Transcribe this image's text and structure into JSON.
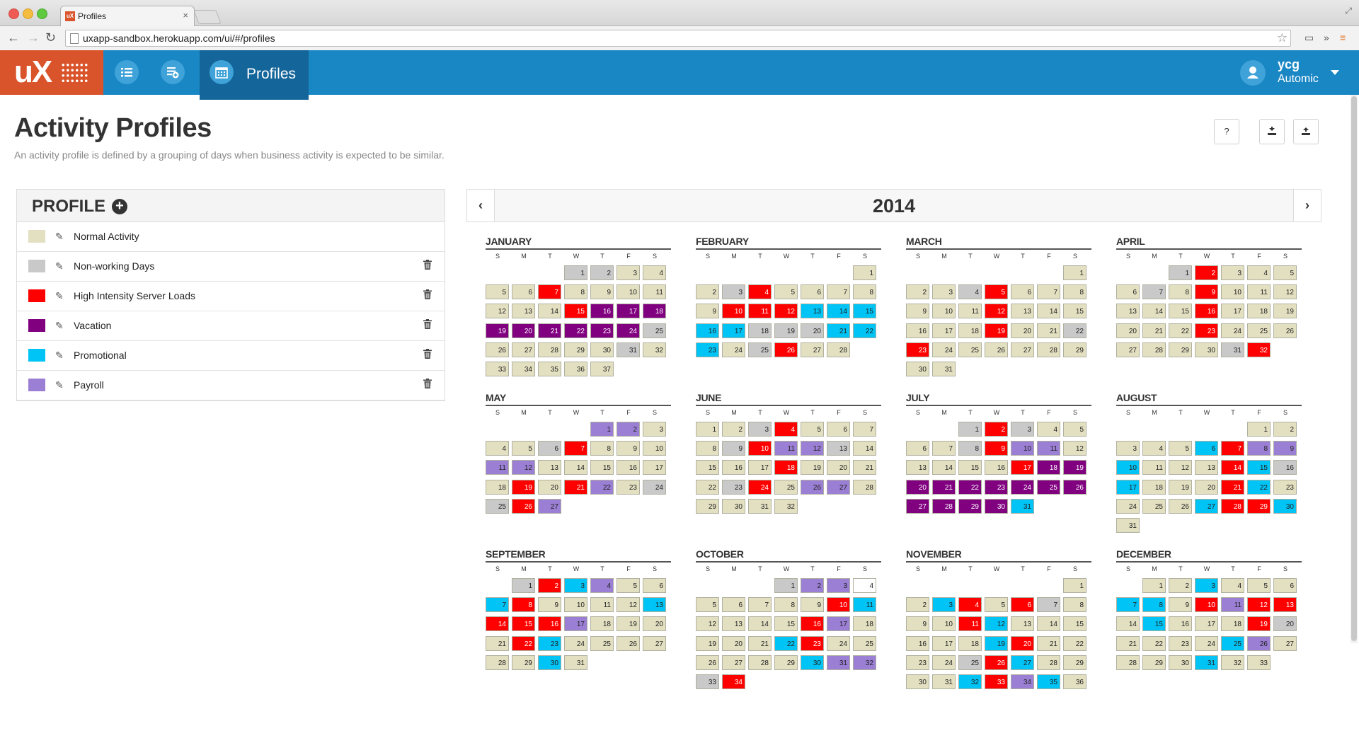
{
  "browser": {
    "tab_title": "Profiles",
    "favicon_text": "uX",
    "url": "uxapp-sandbox.herokuapp.com/ui/#/profiles"
  },
  "appbar": {
    "logo_text": "uX",
    "active_tab_label": "Profiles",
    "user_name": "ycg",
    "user_org": "Automic",
    "brand_color": "#1a87c5",
    "logo_color": "#d9532b"
  },
  "page": {
    "title": "Activity Profiles",
    "subtitle": "An activity profile is defined by a grouping of days when business activity is expected to be similar.",
    "help_label": "?"
  },
  "profile_panel": {
    "title": "PROFILE",
    "items": [
      {
        "label": "Normal Activity",
        "color": "#e3e0c1",
        "deletable": false
      },
      {
        "label": "Non-working Days",
        "color": "#c9c9c9",
        "deletable": true
      },
      {
        "label": "High Intensity Server Loads",
        "color": "#ff0000",
        "deletable": true
      },
      {
        "label": "Vacation",
        "color": "#800080",
        "deletable": true
      },
      {
        "label": "Promotional",
        "color": "#00c4f5",
        "deletable": true
      },
      {
        "label": "Payroll",
        "color": "#9b7fd4",
        "deletable": true
      }
    ]
  },
  "calendar": {
    "year": "2014",
    "weekdays": [
      "S",
      "M",
      "T",
      "W",
      "T",
      "F",
      "S"
    ],
    "months": [
      {
        "name": "JANUARY",
        "offset": 3,
        "codes": "1100002000000023333333331000001000000"
      },
      {
        "name": "FEBRUARY",
        "offset": 6,
        "codes": "0012000002224444411144401200"
      },
      {
        "name": "MARCH",
        "offset": 6,
        "codes": "0001200000020000002001200000000"
      },
      {
        "name": "APRIL",
        "offset": 2,
        "codes": "12000010200000020000002000000012"
      },
      {
        "name": "MAY",
        "offset": 4,
        "codes": "550001200055000000202501125"
      },
      {
        "name": "JUNE",
        "offset": 0,
        "codes": "00120000125510000200001205500000"
      },
      {
        "name": "JULY",
        "offset": 2,
        "codes": "1210000125500000233333333333334"
      },
      {
        "name": "AUGUST",
        "offset": 5,
        "codes": "0000042554000241400024000042240"
      },
      {
        "name": "SEPTEMBER",
        "offset": 1,
        "codes": "1245004200004222500002400000040"
      },
      {
        "name": "OCTOBER",
        "offset": 3,
        "codes": "1556000002400002500004200000045512"
      },
      {
        "name": "NOVEMBER",
        "offset": 6,
        "codes": "004202100024000000420000124000042540"
      },
      {
        "name": "DECEMBER",
        "offset": 1,
        "codes": "004000440252204000210000450000400"
      }
    ]
  }
}
